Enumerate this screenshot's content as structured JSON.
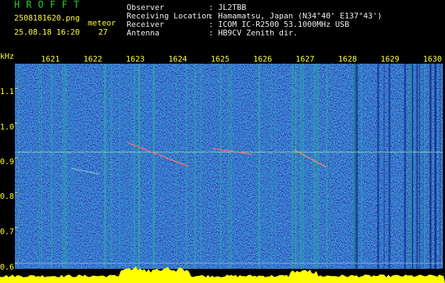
{
  "header": {
    "logo": "HROFFT",
    "filename": "2508181620.png",
    "datetime": "25.08.18 16:20",
    "count_label": "meteor",
    "count_value": "27",
    "rows": [
      {
        "label": "Observer",
        "value": ": JL2TBB"
      },
      {
        "label": "Receiving Location",
        "value": ": Hamamatsu, Japan (N34°40' E137°43')"
      },
      {
        "label": "Receiver",
        "value": ": ICOM IC-R2500 53.1000MHz USB"
      },
      {
        "label": "Antenna",
        "value": ": HB9CV Zenith dir."
      }
    ]
  },
  "axis": {
    "y_unit": "kHz",
    "x_ticks": [
      "1621",
      "1622",
      "1623",
      "1624",
      "1625",
      "1626",
      "1627",
      "1628",
      "1629",
      "1630"
    ],
    "y_ticks": [
      "1.1",
      "1.0",
      "0.9",
      "0.8",
      "0.7",
      "0.6"
    ]
  },
  "colors": {
    "background": "#000000",
    "header_text": "#f0f0f0",
    "info_text": "#ffff33",
    "logo": "#1fd21f",
    "waterfall_base": "#1436a8",
    "floor": "#ffff00"
  }
}
